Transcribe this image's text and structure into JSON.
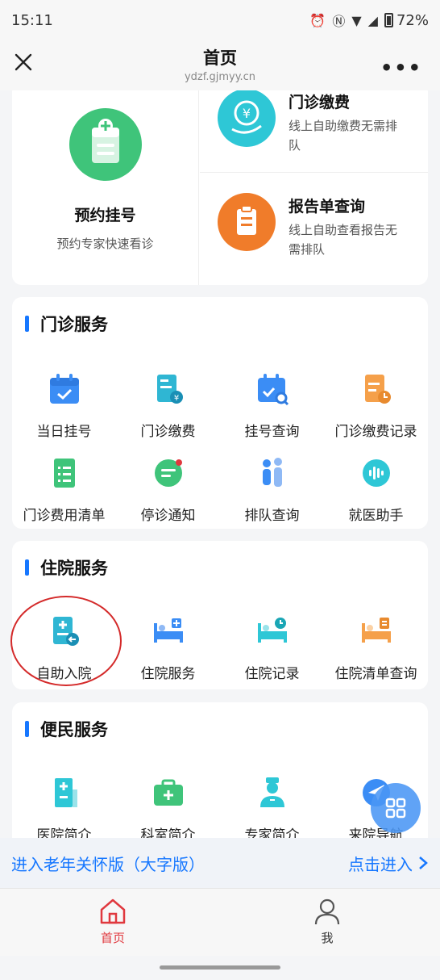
{
  "status": {
    "time": "15:11",
    "battery": "72%"
  },
  "nav": {
    "title": "首页",
    "url": "ydzf.gjmyy.cn"
  },
  "top": {
    "appointment": {
      "title": "预约挂号",
      "desc": "预约专家快速看诊"
    },
    "payment": {
      "title": "门诊缴费",
      "desc": "线上自助缴费无需排队"
    },
    "report": {
      "title": "报告单查询",
      "desc": "线上自助查看报告无需排队"
    }
  },
  "outpatient": {
    "title": "门诊服务",
    "items": [
      "当日挂号",
      "门诊缴费",
      "挂号查询",
      "门诊缴费记录",
      "门诊费用清单",
      "停诊通知",
      "排队查询",
      "就医助手"
    ]
  },
  "inpatient": {
    "title": "住院服务",
    "items": [
      "自助入院",
      "住院服务",
      "住院记录",
      "住院清单查询"
    ]
  },
  "convenience": {
    "title": "便民服务",
    "items": [
      "医院简介",
      "科室简介",
      "专家简介",
      "来院导航"
    ]
  },
  "elder": {
    "left": "进入老年关怀版（大字版）",
    "right": "点击进入"
  },
  "tabs": {
    "home": "首页",
    "me": "我"
  },
  "colors": {
    "accent": "#1677ff",
    "green": "#3fc47a",
    "orange": "#f07c2a",
    "cyan": "#2ec7d6",
    "red": "#e0383e"
  }
}
